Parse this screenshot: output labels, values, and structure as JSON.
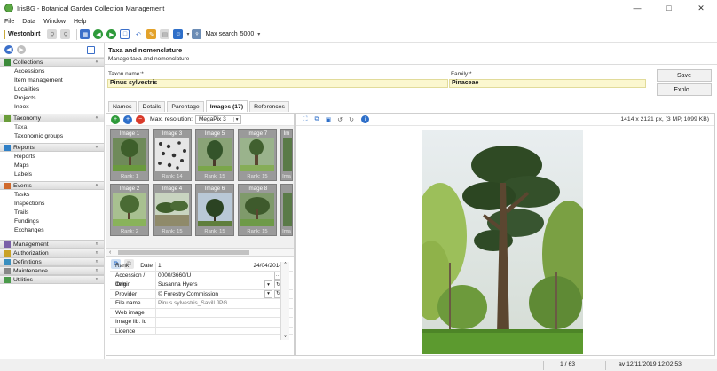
{
  "window": {
    "title": "IrisBG - Botanical Garden Collection Management",
    "minimize": "—",
    "maximize": "□",
    "close": "✕"
  },
  "menu": [
    "File",
    "Data",
    "Window",
    "Help"
  ],
  "toolbar": {
    "site": "Westonbirt",
    "max_search_label": "Max search",
    "max_search_value": "5000"
  },
  "nav": {
    "sections": [
      {
        "title": "Collections",
        "items": [
          "Accessions",
          "Item management",
          "Localities",
          "Projects",
          "Inbox"
        ]
      },
      {
        "title": "Taxonomy",
        "items": [
          "Taxa",
          "Taxonomic groups"
        ]
      },
      {
        "title": "Reports",
        "items": [
          "Reports",
          "Maps",
          "Labels"
        ]
      },
      {
        "title": "Events",
        "items": [
          "Tasks",
          "Inspections",
          "Trails",
          "Fundings",
          "Exchanges"
        ]
      }
    ],
    "collapsed": [
      "Management",
      "Authorization",
      "Definitions",
      "Maintenance",
      "Utilities"
    ]
  },
  "header": {
    "title": "Taxa and nomenclature",
    "subtitle": "Manage taxa and nomenclature"
  },
  "form": {
    "taxon_label": "Taxon name:*",
    "taxon_value": "Pinus sylvestris",
    "family_label": "Family:*",
    "family_value": "Pinaceae",
    "save": "Save",
    "explore": "Explo..."
  },
  "tabs": [
    "Names",
    "Details",
    "Parentage",
    "Images (17)",
    "References"
  ],
  "images": {
    "max_res_label": "Max. resolution:",
    "max_res_value": "MegaPix 3",
    "thumbs": [
      {
        "title": "Image 1",
        "rank": "Rank: 1"
      },
      {
        "title": "Image 3",
        "rank": "Rank: 14"
      },
      {
        "title": "Image 5",
        "rank": "Rank: 15"
      },
      {
        "title": "Image 7",
        "rank": "Rank: 15"
      },
      {
        "title": "Im",
        "rank": "Ima"
      },
      {
        "title": "Image 2",
        "rank": "Rank: 2"
      },
      {
        "title": "Image 4",
        "rank": "Rank: 15"
      },
      {
        "title": "Image 6",
        "rank": "Rank: 15"
      },
      {
        "title": "Image 8",
        "rank": "Rank: 15"
      },
      {
        "title": "",
        "rank": "Ima"
      }
    ]
  },
  "meta": {
    "rows": [
      {
        "k": "Rank",
        "k2": "Date",
        "v": "1",
        "v2": "24/04/2014"
      },
      {
        "k": "Accession / Item",
        "v": "0000/3660/U"
      },
      {
        "k": "Origin",
        "v": "Susanna Hyers"
      },
      {
        "k": "Provider",
        "v": "© Forestry Commission"
      },
      {
        "k": "File name",
        "v": "Pinus sylvestris_Savill.JPG"
      },
      {
        "k": "Web image",
        "v": ""
      },
      {
        "k": "Image lib. Id",
        "v": ""
      },
      {
        "k": "Licence",
        "v": ""
      }
    ]
  },
  "viewer": {
    "info": "1414 x 2121 px, (3 MP, 1099 KB)"
  },
  "status": {
    "page": "1 / 63",
    "timestamp": "av 12/11/2019 12:02:53"
  }
}
